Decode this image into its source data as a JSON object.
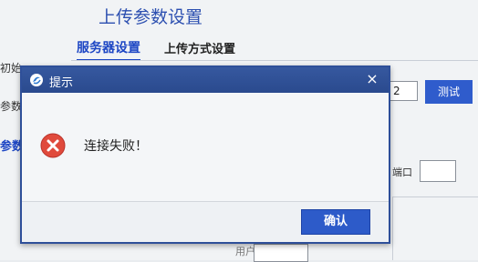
{
  "background": {
    "title": "上传参数设置",
    "tabs": {
      "server_label": "服务器设置",
      "upload_label": "上传方式设置"
    },
    "left_labels": [
      "初始",
      "参数",
      "参数"
    ],
    "port_value": "2",
    "test_button_label": "测试",
    "port_label": "端口",
    "bottom_label": "用户名"
  },
  "dialog": {
    "title": "提示",
    "close_label": "×",
    "message": "连接失败！",
    "ok_label": "确认"
  },
  "colors": {
    "titlebar": "#2e4f99",
    "accent_blue": "#2d5bc9",
    "error_red": "#e04a3c"
  },
  "icons": [
    "app-logo-icon",
    "close-icon",
    "error-icon"
  ]
}
